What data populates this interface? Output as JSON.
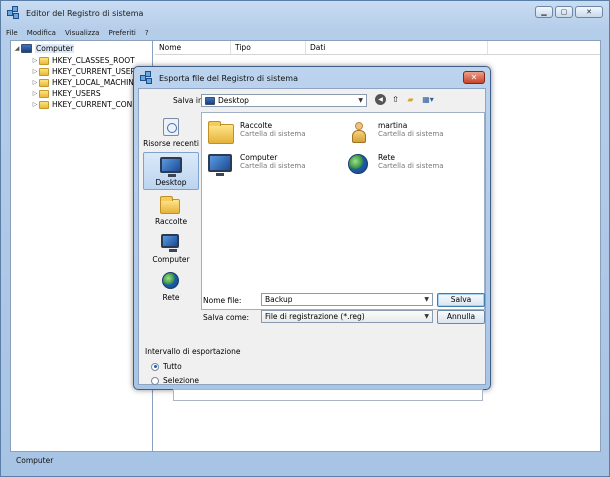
{
  "main_window": {
    "title": "Editor del Registro di sistema",
    "menu": [
      "File",
      "Modifica",
      "Visualizza",
      "Preferiti",
      "?"
    ],
    "window_buttons": {
      "minimize": "▁",
      "maximize": "▢",
      "close": "✕"
    },
    "tree": {
      "root": "Computer",
      "items": [
        "HKEY_CLASSES_ROOT",
        "HKEY_CURRENT_USER",
        "HKEY_LOCAL_MACHINE",
        "HKEY_USERS",
        "HKEY_CURRENT_CONFIG"
      ]
    },
    "columns": [
      "Nome",
      "Tipo",
      "Dati"
    ],
    "status": "Computer"
  },
  "dialog": {
    "title": "Esporta file del Registro di sistema",
    "close_glyph": "✕",
    "save_in_label": "Salva in:",
    "save_in_value": "Desktop",
    "places": [
      "Risorse recenti",
      "Desktop",
      "Raccolte",
      "Computer",
      "Rete"
    ],
    "selected_place": "Desktop",
    "files": [
      {
        "name": "Raccolte",
        "desc": "Cartella di sistema",
        "icon": "library-folder-icon"
      },
      {
        "name": "martina",
        "desc": "Cartella di sistema",
        "icon": "user-folder-icon"
      },
      {
        "name": "Computer",
        "desc": "Cartella di sistema",
        "icon": "computer-icon"
      },
      {
        "name": "Rete",
        "desc": "Cartella di sistema",
        "icon": "network-icon"
      }
    ],
    "filename_label": "Nome file:",
    "filename_value": "Backup",
    "savetype_label": "Salva come:",
    "savetype_value": "File di registrazione (*.reg)",
    "save_button": "Salva",
    "cancel_button": "Annulla",
    "export_range": {
      "title": "Intervallo di esportazione",
      "option_all": "Tutto",
      "option_selection": "Selezione",
      "selected": "Tutto",
      "selection_value": ""
    }
  },
  "colors": {
    "desktop": "#2e7fd6",
    "window_frame": "#b4cde9",
    "dialog_body": "#f0f0f0",
    "close_red": "#c9432a"
  }
}
